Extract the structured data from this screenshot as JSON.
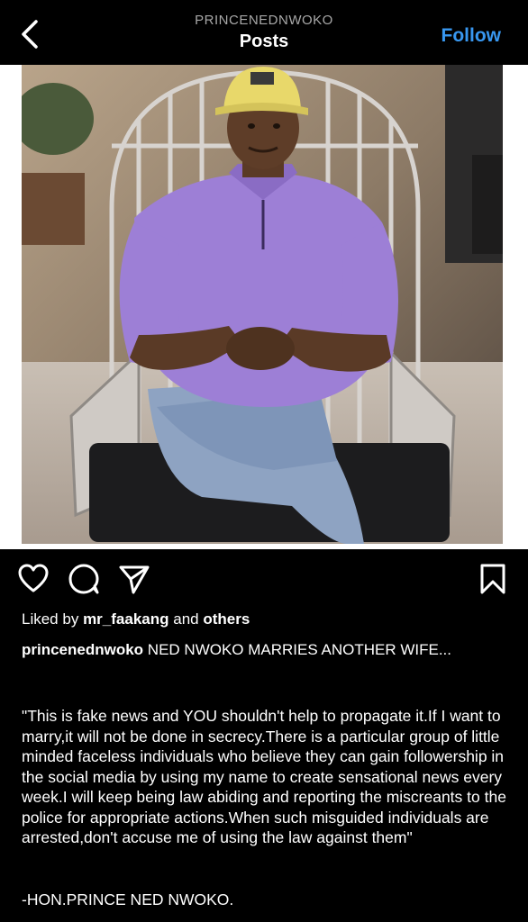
{
  "header": {
    "account": "PRINCENEDNWOKO",
    "title": "Posts",
    "follow_label": "Follow"
  },
  "post": {
    "liked_by_prefix": "Liked by",
    "liked_by_user": "mr_faakang",
    "liked_by_and": "and",
    "liked_by_others": "others",
    "caption_user": "princenednwoko",
    "caption_text": " NED  NWOKO MARRIES ANOTHER WIFE...",
    "quote": "\"This is fake news and YOU shouldn't help to propagate it.If I want to marry,it will not be done in secrecy.There is a particular group of little minded faceless individuals who believe they can gain followership in the social media by using my name to create sensational news every week.I will keep being law abiding and reporting the miscreants to the police for appropriate actions.When such misguided individuals are arrested,don't accuse me of using the law against them\"",
    "signature": "-HON.PRINCE NED NWOKO."
  },
  "icons": {
    "back": "chevron-left-icon",
    "like": "heart-icon",
    "comment": "comment-icon",
    "share": "send-icon",
    "save": "bookmark-icon"
  },
  "colors": {
    "background": "#000000",
    "accent": "#3897f0",
    "shirt": "#9d7fd6",
    "cap": "#e8d86a"
  }
}
